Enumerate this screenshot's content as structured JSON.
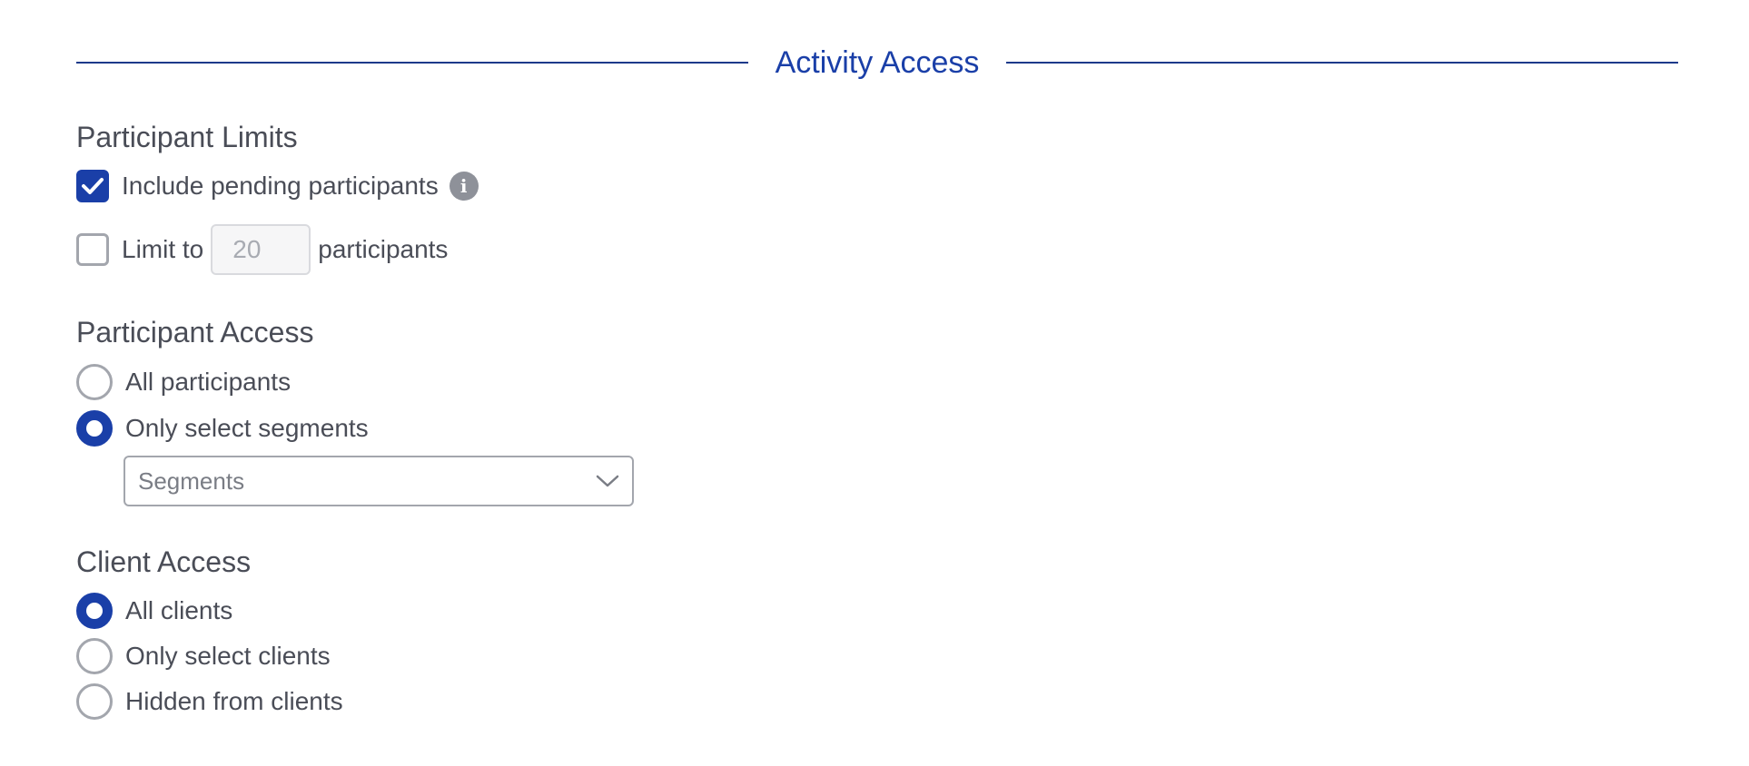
{
  "section": {
    "title": "Activity Access"
  },
  "participant_limits": {
    "title": "Participant Limits",
    "include_pending": {
      "label": "Include pending participants",
      "checked": true,
      "info_icon": "info-icon"
    },
    "limit": {
      "prefix": "Limit to",
      "placeholder": "20",
      "suffix": "participants",
      "checked": false
    }
  },
  "participant_access": {
    "title": "Participant Access",
    "options": [
      {
        "label": "All participants",
        "selected": false
      },
      {
        "label": "Only select segments",
        "selected": true
      }
    ],
    "segments_select": {
      "placeholder": "Segments",
      "icon": "chevron-down-icon"
    }
  },
  "client_access": {
    "title": "Client Access",
    "options": [
      {
        "label": "All clients",
        "selected": true
      },
      {
        "label": "Only select clients",
        "selected": false
      },
      {
        "label": "Hidden from clients",
        "selected": false
      }
    ]
  },
  "colors": {
    "accent": "#1a3fa8",
    "rule": "#1c3a8a",
    "text": "#4a4d57",
    "border": "#a3a6ad"
  }
}
